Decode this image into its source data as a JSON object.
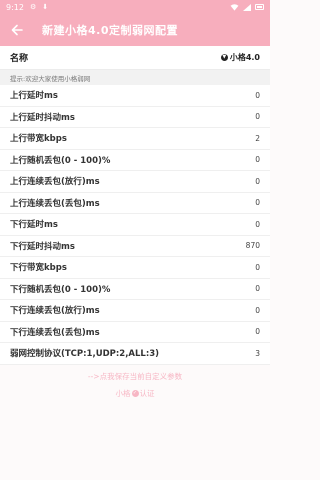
{
  "status_bar": {
    "time": "9:12",
    "icons": [
      "gear-icon",
      "download-icon"
    ]
  },
  "header": {
    "title": "新建小格4.0定制弱网配置",
    "back_icon": "arrow-left-icon"
  },
  "name": {
    "label": "名称",
    "value": "小格4.0"
  },
  "hint": "提示:欢迎大家使用小格弱网",
  "params": [
    {
      "label": "上行延时ms",
      "value": "0"
    },
    {
      "label": "上行延时抖动ms",
      "value": "0"
    },
    {
      "label": "上行带宽kbps",
      "value": "2"
    },
    {
      "label": "上行随机丢包(0 - 100)%",
      "value": "0"
    },
    {
      "label": "上行连续丢包(放行)ms",
      "value": "0"
    },
    {
      "label": "上行连续丢包(丢包)ms",
      "value": "0"
    },
    {
      "label": "下行延时ms",
      "value": "0"
    },
    {
      "label": "下行延时抖动ms",
      "value": "870"
    },
    {
      "label": "下行带宽kbps",
      "value": "0"
    },
    {
      "label": "下行随机丢包(0 - 100)%",
      "value": "0"
    },
    {
      "label": "下行连续丢包(放行)ms",
      "value": "0"
    },
    {
      "label": "下行连续丢包(丢包)ms",
      "value": "0"
    },
    {
      "label": "弱网控制协议(TCP:1,UDP:2,ALL:3)",
      "value": "3"
    }
  ],
  "footer": {
    "save_link": "-->点我保存当前自定义参数",
    "author_prefix": "小格",
    "author_suffix": "认证"
  },
  "colors": {
    "accent": "#f7aebd",
    "footer_text": "#f7b6c4"
  }
}
